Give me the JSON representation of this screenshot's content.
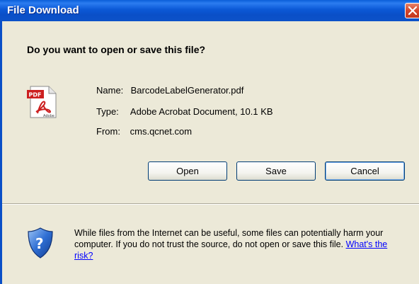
{
  "window": {
    "title": "File Download",
    "close_icon": "close-icon"
  },
  "dialog": {
    "question": "Do you want to open or save this file?",
    "file_icon": "pdf-file-icon",
    "file": {
      "name_label": "Name:",
      "name_value": "BarcodeLabelGenerator.pdf",
      "type_label": "Type:",
      "type_value": "Adobe Acrobat Document, 10.1 KB",
      "from_label": "From:",
      "from_value": "cms.qcnet.com"
    },
    "buttons": {
      "open": "Open",
      "save": "Save",
      "cancel": "Cancel"
    },
    "warning_icon": "security-shield-icon",
    "warning_text": "While files from the Internet can be useful, some files can potentially harm your computer. If you do not trust the source, do not open or save this file.",
    "warning_link": "What's the risk?"
  },
  "colors": {
    "titlebar": "#0a5fd8",
    "dialog_bg": "#ece9d8",
    "link": "#0000ff",
    "close_button": "#d4462a"
  }
}
